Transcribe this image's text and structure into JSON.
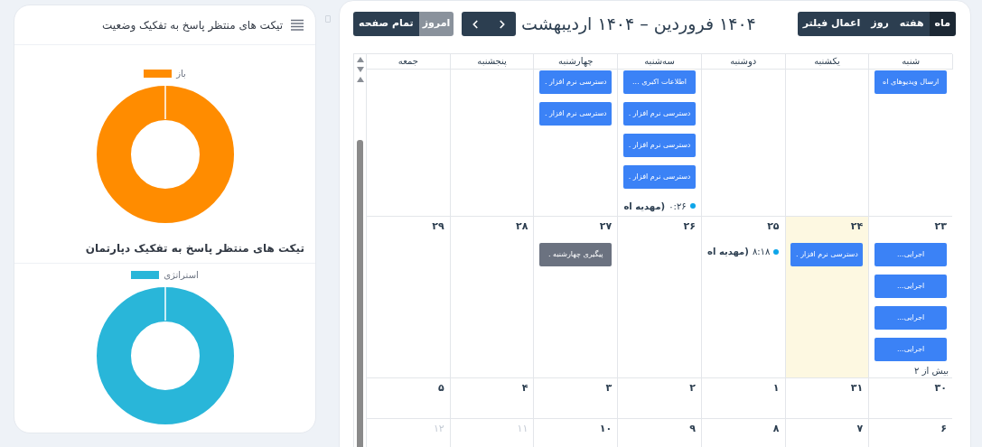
{
  "left_panel": {
    "charts": [
      {
        "title": "تیکت های منتظر پاسخ به تفکیک وضعیت",
        "bold": false,
        "has_menu": true,
        "legend": [
          {
            "label": "باز",
            "color": "#ff8c00"
          }
        ]
      },
      {
        "title": "تیکت های منتظر پاسخ به تفکیک دپارتمان",
        "bold": true,
        "has_menu": false,
        "legend": [
          {
            "label": "استراتژی",
            "color": "#29b6d9"
          }
        ]
      }
    ]
  },
  "calendar": {
    "toolbar": {
      "views": [
        {
          "label": "ماه",
          "selected": true
        },
        {
          "label": "هفته",
          "selected": false
        },
        {
          "label": "روز",
          "selected": false
        },
        {
          "label": "اعمال فیلتر",
          "selected": false
        }
      ],
      "title": "۱۴۰۴ فروردین – ۱۴۰۴ اردیبهشت",
      "today_button": {
        "label": "امروز",
        "disabled": true
      },
      "fullscreen_button": {
        "label": "تمام صفحه"
      }
    },
    "weekdays": [
      "شنبه",
      "یکشنبه",
      "دوشنبه",
      "سه‌شنبه",
      "چهارشنبه",
      "پنجشنبه",
      "جمعه"
    ],
    "weeks": [
      {
        "days": [
          {
            "today": false,
            "events": [
              {
                "kind": "block",
                "title": "ارسال ویدیوهای اه",
                "color": "#3b82f6"
              }
            ]
          },
          {
            "today": false
          },
          {
            "today": false
          },
          {
            "today": false,
            "events": [
              {
                "kind": "block",
                "title": "اطلاعات اکبری ...",
                "color": "#3b82f6"
              },
              {
                "kind": "block",
                "title": "دسترسی نرم افزار .",
                "color": "#3b82f6"
              },
              {
                "kind": "block",
                "title": "دسترسی نرم افزار .",
                "color": "#3b82f6"
              },
              {
                "kind": "block",
                "title": "دسترسی نرم افزار .",
                "color": "#3b82f6"
              },
              {
                "kind": "dot",
                "time": "۰:۲۶",
                "title": "(مهدیه اه",
                "color": "#0ea5e9"
              }
            ]
          },
          {
            "today": false,
            "events": [
              {
                "kind": "block",
                "title": "دسترسی نرم افزار .",
                "color": "#3b82f6"
              },
              {
                "kind": "block",
                "title": "دسترسی نرم افزار .",
                "color": "#3b82f6"
              }
            ]
          },
          {
            "today": false
          },
          {
            "today": false
          }
        ]
      },
      {
        "days": [
          {
            "date": "۲۳",
            "today": false,
            "muted": false,
            "events": [
              {
                "kind": "block",
                "title": "اجرایی...",
                "color": "#3b82f6"
              },
              {
                "kind": "block",
                "title": "اجرایی...",
                "color": "#3b82f6"
              },
              {
                "kind": "block",
                "title": "اجرایی...",
                "color": "#3b82f6"
              },
              {
                "kind": "block",
                "title": "اجرایی...",
                "color": "#3b82f6"
              }
            ],
            "more": "بیش از ۲"
          },
          {
            "date": "۲۴",
            "today": true,
            "muted": false,
            "events": [
              {
                "kind": "block",
                "title": "دسترسی نرم افزار .",
                "color": "#3b82f6"
              }
            ]
          },
          {
            "date": "۲۵",
            "today": false,
            "muted": false,
            "events": [
              {
                "kind": "dot",
                "time": "۸:۱۸",
                "title": "(مهدیه اه",
                "color": "#0ea5e9"
              }
            ]
          },
          {
            "date": "۲۶",
            "today": false,
            "muted": false
          },
          {
            "date": "۲۷",
            "today": false,
            "muted": false,
            "events": [
              {
                "kind": "block",
                "title": "پیگیری چهارشنبه .",
                "color": "#6b7280"
              }
            ]
          },
          {
            "date": "۲۸",
            "today": false,
            "muted": false
          },
          {
            "date": "۲۹",
            "today": false,
            "muted": false
          }
        ]
      },
      {
        "days": [
          {
            "date": "۳۰",
            "today": false,
            "muted": false
          },
          {
            "date": "۳۱",
            "today": false,
            "muted": false
          },
          {
            "date": "۱",
            "today": false,
            "muted": false
          },
          {
            "date": "۲",
            "today": false,
            "muted": false
          },
          {
            "date": "۳",
            "today": false,
            "muted": false
          },
          {
            "date": "۴",
            "today": false,
            "muted": false
          },
          {
            "date": "۵",
            "today": false,
            "muted": false
          }
        ]
      },
      {
        "days": [
          {
            "date": "۶",
            "today": false,
            "muted": false
          },
          {
            "date": "۷",
            "today": false,
            "muted": false
          },
          {
            "date": "۸",
            "today": false,
            "muted": false
          },
          {
            "date": "۹",
            "today": false,
            "muted": false
          },
          {
            "date": "۱۰",
            "today": false,
            "muted": false
          },
          {
            "date": "۱۱",
            "today": false,
            "muted": true
          },
          {
            "date": "۱۲",
            "today": false,
            "muted": true
          }
        ]
      }
    ]
  }
}
